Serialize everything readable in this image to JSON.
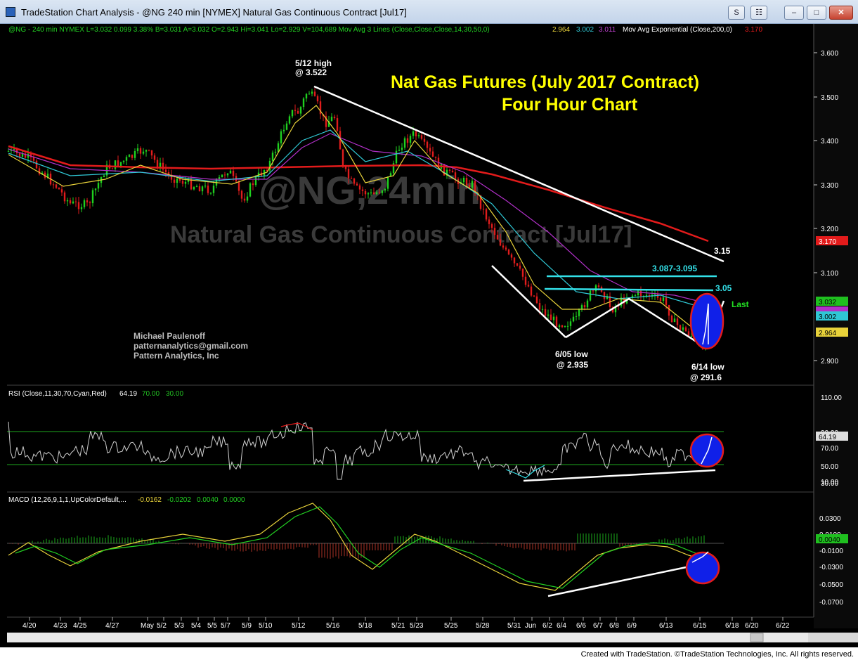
{
  "window": {
    "title": "TradeStation Chart Analysis - @NG 240 min [NYMEX] Natural Gas Continuous Contract [Jul17]",
    "btn_s": "S",
    "btn_grid": "☷",
    "btn_min": "–",
    "btn_max": "□",
    "btn_close": "✕"
  },
  "header": {
    "symbol_line": "@NG - 240 min  NYMEX  L=3.032  0.099  3.38%  B=3.031  A=3.032  O=2.943  Hi=3.041  Lo=2.929  V=104,689  Mov Avg 3 Lines (Close,Close,Close,14,30,50,0)",
    "mav_values": [
      "2.964",
      "3.002",
      "3.011"
    ],
    "mav_exp_label": "Mov Avg Exponential (Close,200,0)",
    "mav_exp_value": "3.170"
  },
  "watermark": {
    "symbol": "@NG,24min",
    "name": "Natural Gas Continuous Contract [Jul17]"
  },
  "annotations": {
    "headline_1": "Nat Gas Futures (July 2017 Contract)",
    "headline_2": "Four Hour Chart",
    "high_1": "5/12 high",
    "high_2": "@ 3.522",
    "low_605_1": "6/05 low",
    "low_605_2": "@ 2.935",
    "low_614_1": "6/14 low",
    "low_614_2": "@ 291.6",
    "level_315": "3.15",
    "level_range": "3.087-3.095",
    "level_305": "3.05",
    "last": "Last",
    "author_1": "Michael Paulenoff",
    "author_2": "patternanalytics@gmail.com",
    "author_3": "Pattern Analytics, Inc"
  },
  "rsi_header": {
    "label": "RSI (Close,11,30,70,Cyan,Red)",
    "value": "64.19",
    "ob": "70.00",
    "os": "30.00"
  },
  "macd_header": {
    "label": "MACD (12,26,9,1,1,UpColorDefault,...",
    "v1": "-0.0162",
    "v2": "-0.0202",
    "v3": "0.0040",
    "v4": "0.0000"
  },
  "price_axis": {
    "ticks": [
      "3.600",
      "3.500",
      "3.400",
      "3.300",
      "3.200",
      "3.100",
      "2.900"
    ],
    "badges": {
      "ema": "3.170",
      "last": "3.032",
      "mav30": "3.002",
      "mav14": "2.964"
    }
  },
  "rsi_axis": {
    "ticks": [
      "110.00",
      "90.00",
      "70.00",
      "50.00",
      "30.00",
      "10.00"
    ],
    "badge": "64.19"
  },
  "macd_axis": {
    "ticks": [
      "0.0300",
      "0.0100",
      "-0.0100",
      "-0.0300",
      "-0.0500",
      "-0.0700"
    ],
    "badge": "0.0040"
  },
  "date_axis": [
    "4/20",
    "4/23",
    "4/25",
    "4/27",
    "May",
    "5/2",
    "5/3",
    "5/4",
    "5/5",
    "5/7",
    "5/9",
    "5/10",
    "5/12",
    "5/16",
    "5/18",
    "5/21",
    "5/23",
    "5/25",
    "5/28",
    "5/31",
    "Jun",
    "6/2",
    "6/4",
    "6/6",
    "6/7",
    "6/8",
    "6/9",
    "6/13",
    "6/15",
    "6/18",
    "6/20",
    "6/22"
  ],
  "footer": "Created with TradeStation. ©TradeStation Technologies, Inc. All rights reserved.",
  "colors": {
    "annotation_yellow": "#ffff00",
    "cyan": "#33e0e8",
    "ema_red": "#e31b1b",
    "mav14": "#e8d23a",
    "mav30": "#2fc7d4",
    "mav50": "#b130c8",
    "up_candle": "#1fd01f",
    "down_candle": "#e01c1c",
    "highlight_blue": "#1020e8"
  }
}
